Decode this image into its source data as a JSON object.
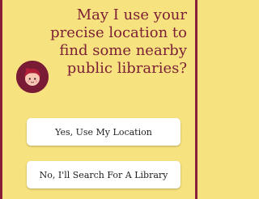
{
  "prompt": {
    "line1": "May I use your",
    "line2": "precise location to",
    "line3": "find some nearby",
    "line4": "public libraries?"
  },
  "buttons": {
    "yes_label": "Yes, Use My Location",
    "no_label": "No, I'll Search For A Library"
  },
  "avatar": {
    "icon": "librarian-mascot-icon"
  },
  "colors": {
    "background": "#f6e27e",
    "accent": "#7b1e36",
    "button": "#ffffff"
  }
}
